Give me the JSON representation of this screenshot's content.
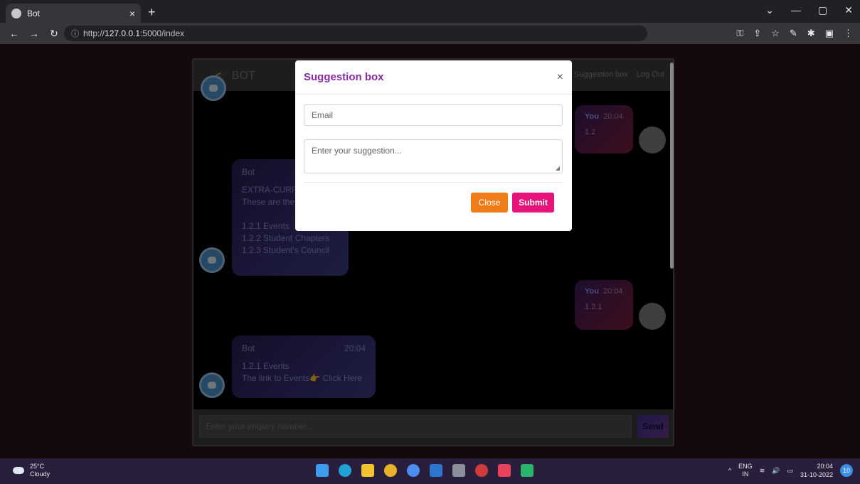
{
  "browser": {
    "tab_title": "Bot",
    "tab_close": "×",
    "new_tab": "+",
    "url_prefix": "http://",
    "url_host": "127.0.0.1",
    "url_rest": ":5000/index",
    "window_controls": [
      "⌄",
      "—",
      "▢",
      "✕"
    ]
  },
  "app": {
    "brand": "BOT",
    "nav": [
      "Suggestion box",
      "Log Out"
    ],
    "messages": [
      {
        "from": "bot",
        "title": "Bot",
        "time": "",
        "lines": [
          "EXTRA-CURR",
          "These are the",
          "",
          "1.2.1 Events",
          "1.2.2 Student Chapters",
          "1.2.3 Student's Council"
        ]
      },
      {
        "from": "you",
        "label": "You",
        "time": "20:04",
        "text": "1.2"
      },
      {
        "from": "you",
        "label": "You",
        "time": "20:04",
        "text": "1.2.1"
      },
      {
        "from": "bot",
        "title": "Bot",
        "time": "20:04",
        "lines": [
          "1.2.1 Events",
          "The link to Events👉 Click Here"
        ]
      }
    ],
    "input_placeholder": "Enter your enquiry number...",
    "send_label": "Send"
  },
  "modal": {
    "title": "Suggestion box",
    "close_icon": "×",
    "email_placeholder": "Email",
    "suggestion_placeholder": "Enter your suggestion...",
    "close_label": "Close",
    "submit_label": "Submit"
  },
  "taskbar": {
    "temperature": "25°C",
    "condition": "Cloudy",
    "lang": "ENG",
    "region": "IN",
    "time": "20:04",
    "date": "31-10-2022",
    "notifications": "10"
  },
  "colors": {
    "modal_title": "#8a2aa6",
    "close_button": "#f07c1a",
    "submit_button": "#e5137a"
  }
}
